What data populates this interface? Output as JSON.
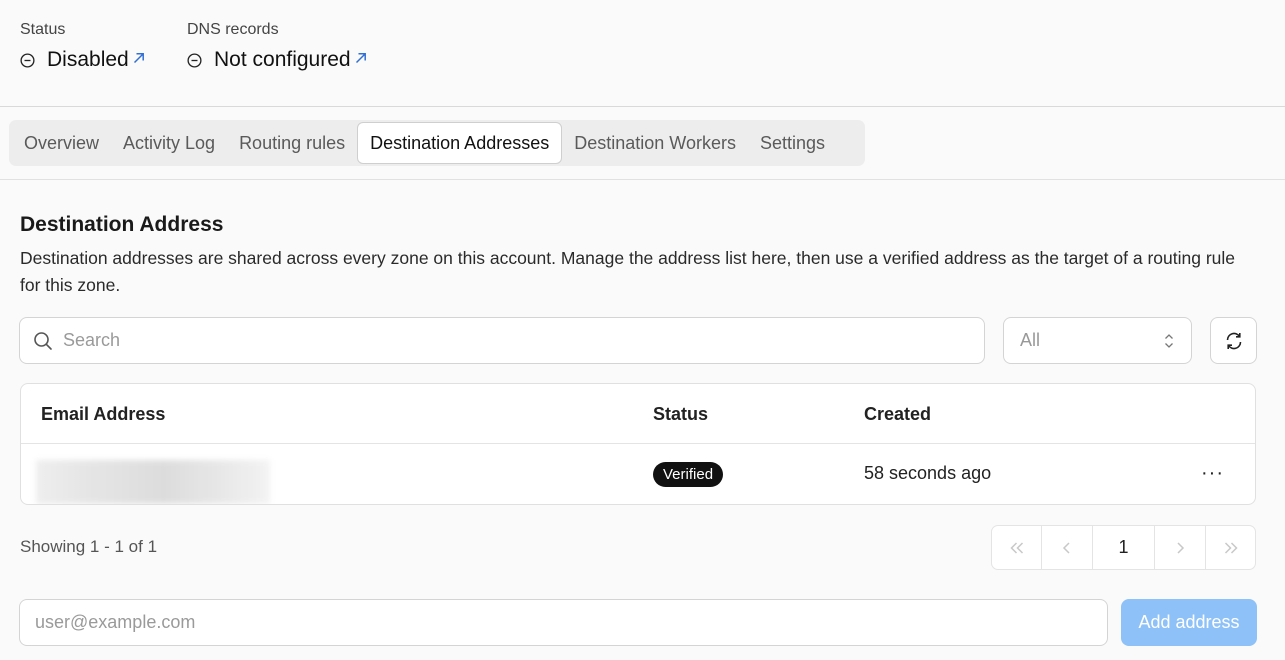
{
  "header": {
    "status": {
      "label": "Status",
      "value": "Disabled"
    },
    "dns": {
      "label": "DNS records",
      "value": "Not configured"
    }
  },
  "tabs": [
    {
      "label": "Overview",
      "active": false
    },
    {
      "label": "Activity Log",
      "active": false
    },
    {
      "label": "Routing rules",
      "active": false
    },
    {
      "label": "Destination Addresses",
      "active": true
    },
    {
      "label": "Destination Workers",
      "active": false
    },
    {
      "label": "Settings",
      "active": false
    }
  ],
  "section": {
    "title": "Destination Address",
    "description": "Destination addresses are shared across every zone on this account. Manage the address list here, then use a verified address as the target of a routing rule for this zone."
  },
  "filters": {
    "search_placeholder": "Search",
    "select_value": "All"
  },
  "table": {
    "columns": [
      "Email Address",
      "Status",
      "Created"
    ],
    "rows": [
      {
        "email": "",
        "status": "Verified",
        "created": "58 seconds ago",
        "actions": "···"
      }
    ]
  },
  "pagination": {
    "showing": "Showing 1 - 1 of 1",
    "current_page": "1"
  },
  "add_form": {
    "placeholder": "user@example.com",
    "button_label": "Add address"
  },
  "colors": {
    "accent_link": "#2f6fd6",
    "add_button_disabled": "#8ec1f7",
    "badge_bg": "#111111"
  }
}
